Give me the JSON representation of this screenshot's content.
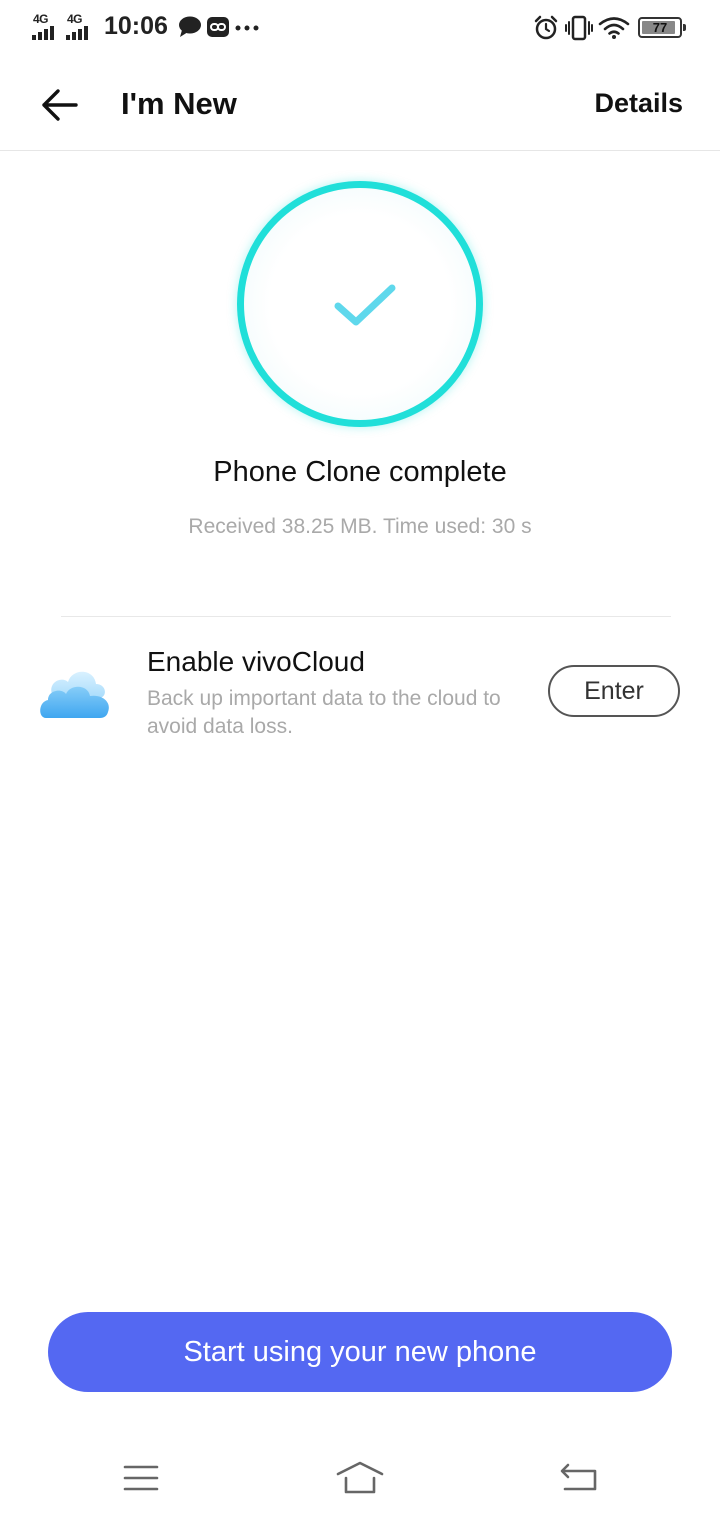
{
  "status_bar": {
    "network_1": "4G",
    "network_2": "4G",
    "time": "10:06",
    "battery_level": "77",
    "icons": [
      "signal-icon",
      "signal-icon",
      "message-icon",
      "link-icon",
      "more-dots-icon",
      "alarm-icon",
      "vibrate-icon",
      "wifi-icon",
      "battery-icon"
    ]
  },
  "app_bar": {
    "title": "I'm New",
    "action_label": "Details"
  },
  "result": {
    "title": "Phone Clone complete",
    "subtitle": "Received 38.25 MB. Time used: 30 s"
  },
  "cloud": {
    "title": "Enable vivoCloud",
    "description": "Back up important data to the cloud to avoid data loss.",
    "button_label": "Enter"
  },
  "primary_button": {
    "label": "Start using your new phone"
  },
  "colors": {
    "ring": "#20dfd9",
    "check": "#5fd8ec",
    "primary_button": "#5468f2",
    "secondary_text": "#a9a9a9",
    "cloud": "#5bb8f5"
  },
  "nav_bar": {
    "icons": [
      "menu-icon",
      "home-icon",
      "back-nav-icon"
    ]
  }
}
